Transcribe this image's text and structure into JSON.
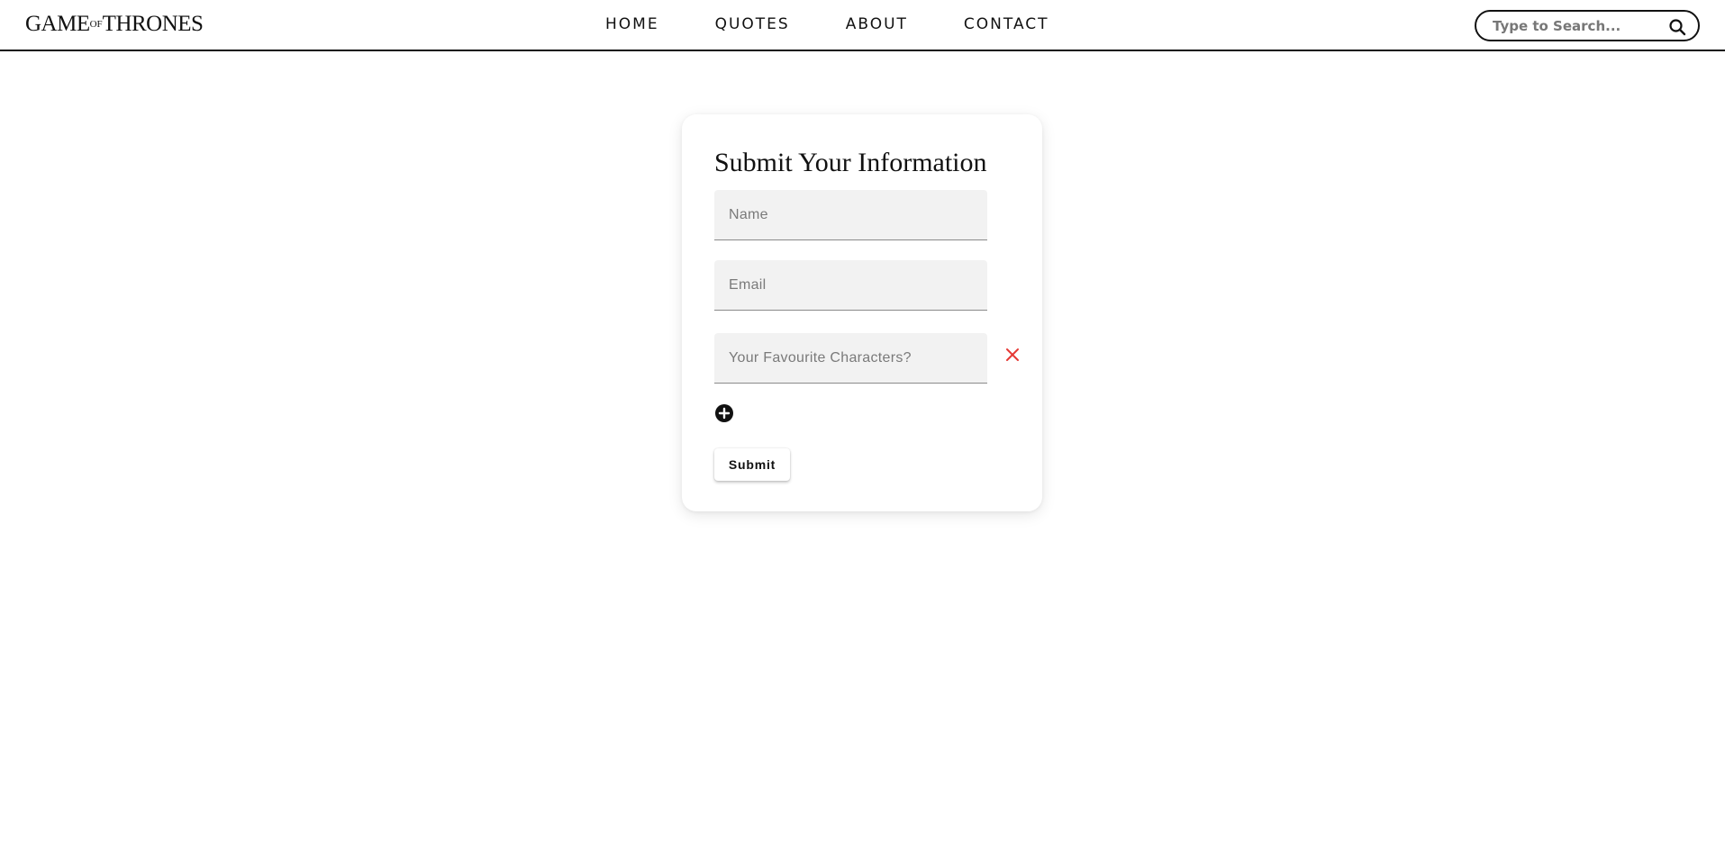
{
  "header": {
    "logo": {
      "part1": "GAME",
      "part2": "OF",
      "part3": "THRONES"
    },
    "nav": [
      {
        "label": "HOME"
      },
      {
        "label": "QUOTES"
      },
      {
        "label": "ABOUT"
      },
      {
        "label": "CONTACT"
      }
    ],
    "search": {
      "placeholder": "Type to Search...",
      "value": "",
      "icon": "search-icon"
    }
  },
  "form": {
    "title": "Submit Your Information",
    "fields": {
      "name": {
        "placeholder": "Name",
        "value": ""
      },
      "email": {
        "placeholder": "Email",
        "value": ""
      },
      "characters": {
        "placeholder": "Your Favourite Characters?",
        "value": ""
      }
    },
    "remove_icon": "close-icon",
    "add_icon": "add-circle-icon",
    "submit_label": "Submit"
  },
  "colors": {
    "text": "#111111",
    "remove": "#e53935",
    "field_bg": "#f2f2f2"
  }
}
